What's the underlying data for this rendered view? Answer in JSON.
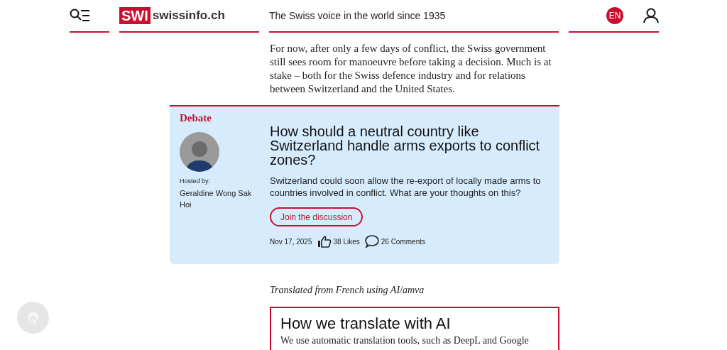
{
  "header": {
    "logo_badge": "SWI",
    "logo_text": "swissinfo.ch",
    "tagline": "The Swiss voice in the world since 1935",
    "language": "EN"
  },
  "paragraph": "For now, after only a few days of conflict, the Swiss government still sees room for manoeuvre before taking a decision. Much is at stake – both for the Swiss defence industry and for relations between Switzerland and the United States.",
  "debate": {
    "label": "Debate",
    "hosted_by": "Hosted by:",
    "host": "Geraldine Wong Sak Hoi",
    "title": "How should a neutral country like Switzerland handle arms exports to conflict zones?",
    "summary": "Switzerland could soon allow the re-export of locally made arms to countries involved in conflict. What are your thoughts on this?",
    "button": "Join the discussion",
    "date": "Nov 17, 2025",
    "likes": "38 Likes",
    "comments": "26 Comments"
  },
  "translation_note": "Translated from French using AI/amva",
  "ai_box": {
    "title": "How we translate with AI",
    "text": "We use automatic translation tools, such as DeepL and Google"
  }
}
